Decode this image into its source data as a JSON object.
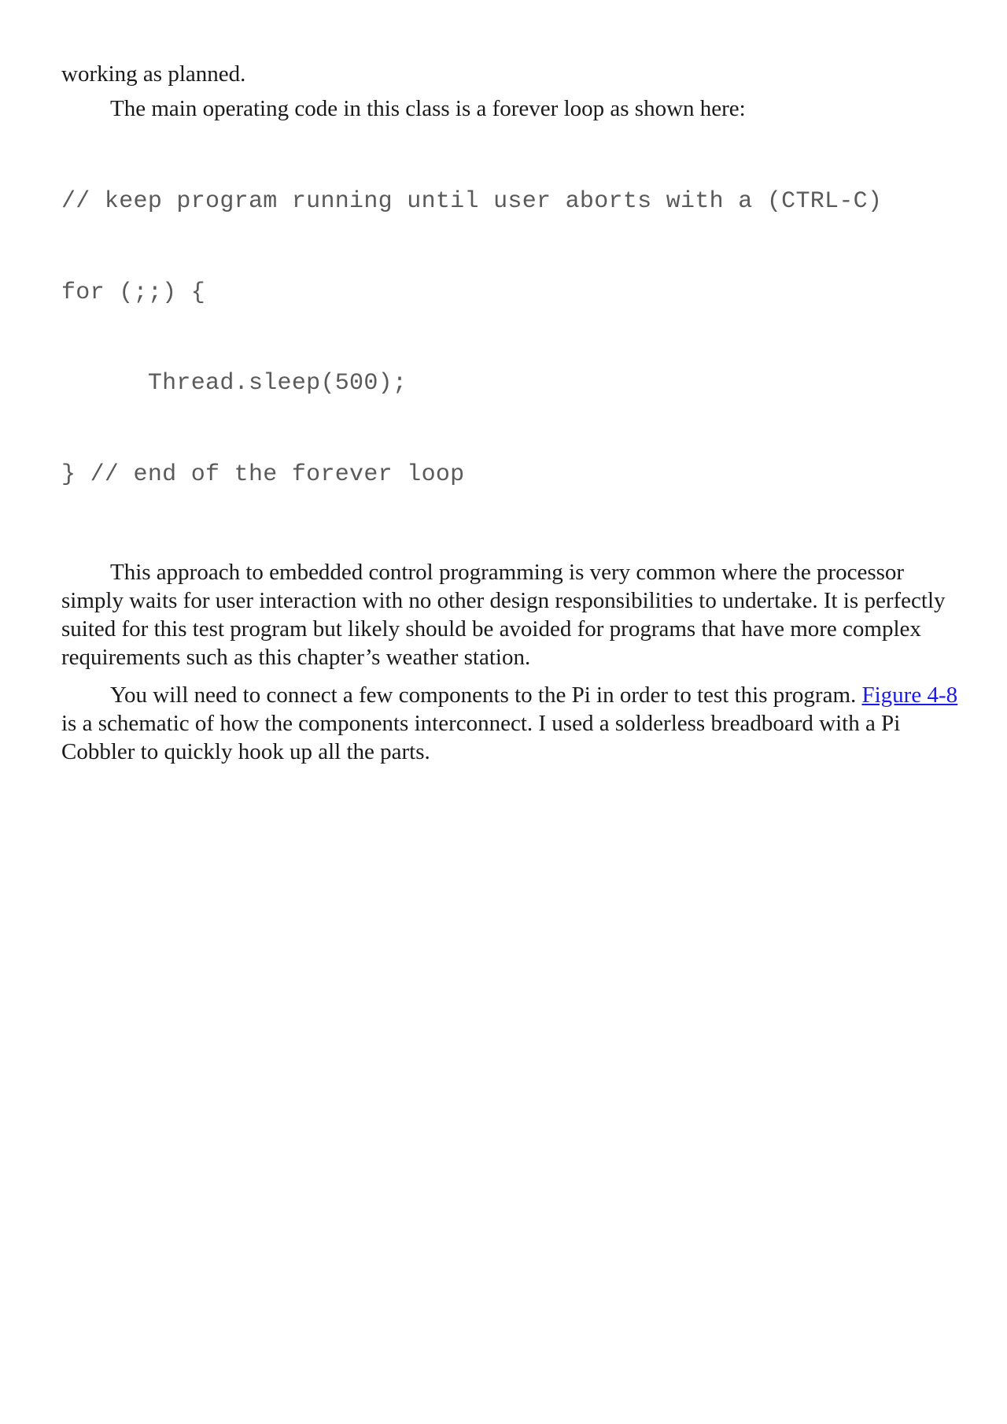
{
  "document": {
    "paragraphs": {
      "continuation": "working as planned.",
      "intro": "The main operating code in this class is a forever loop as shown here:",
      "approach": "This approach to embedded control programming is very common where the processor simply waits for user interaction with no other design responsibilities to undertake. It is perfectly suited for this test program but likely should be avoided for programs that have more complex requirements such as this chapter’s weather station.",
      "connect": {
        "before_link": "You will need to connect a few components to the Pi in order to test this program.",
        "link_text": "Figure 4-8",
        "after_link": " is a schematic of how the components interconnect. I used a solderless breadboard with a Pi Cobbler to quickly hook up all the parts."
      }
    },
    "code_block": {
      "lines": [
        "// keep program running until user aborts with a (CTRL-C)",
        "for (;;) {",
        "      Thread.sleep(500);",
        "} // end of the forever loop"
      ]
    },
    "colors": {
      "text": "#1a1a1a",
      "code": "#5a5a5a",
      "link": "#1a1aee"
    }
  }
}
